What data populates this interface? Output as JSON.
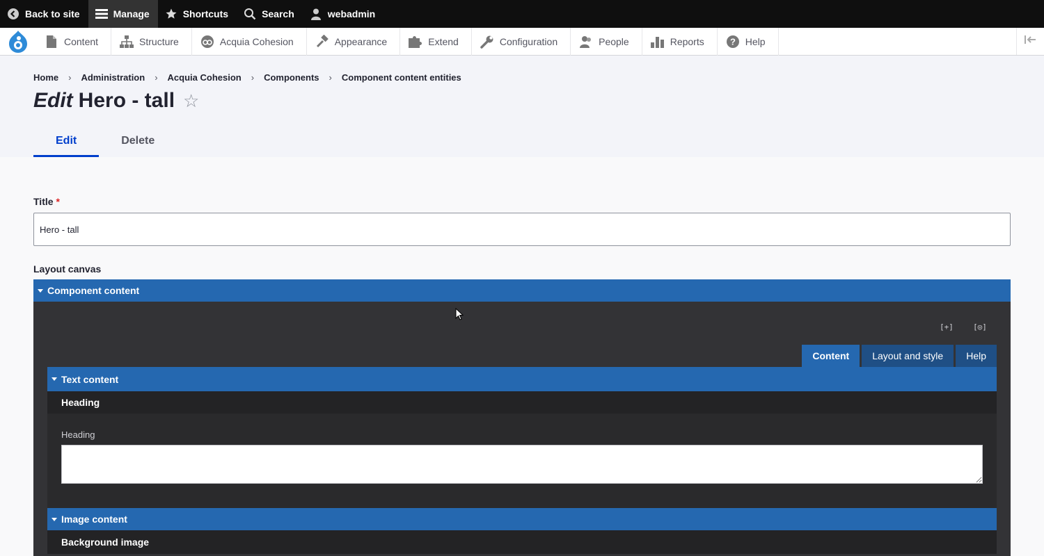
{
  "toolbar": {
    "back": "Back to site",
    "manage": "Manage",
    "shortcuts": "Shortcuts",
    "search": "Search",
    "user": "webadmin"
  },
  "tray": {
    "items": [
      "Content",
      "Structure",
      "Acquia Cohesion",
      "Appearance",
      "Extend",
      "Configuration",
      "People",
      "Reports",
      "Help"
    ],
    "icons": [
      "file-icon",
      "structure-icon",
      "cohesion-icon",
      "hammer-icon",
      "puzzle-icon",
      "wrench-icon",
      "people-icon",
      "reports-icon",
      "help-icon"
    ]
  },
  "breadcrumb": [
    "Home",
    "Administration",
    "Acquia Cohesion",
    "Components",
    "Component content entities"
  ],
  "page": {
    "title_prefix": "Edit",
    "title": "Hero - tall",
    "star": "☆"
  },
  "tabs": [
    "Edit",
    "Delete"
  ],
  "form": {
    "title_label": "Title",
    "required_mark": "*",
    "title_value": "Hero - tall",
    "layout_canvas_label": "Layout canvas"
  },
  "canvas": {
    "component_content": "Component content",
    "expand_icon": "[+]",
    "preview_icon": "[◎]",
    "tabs": [
      "Content",
      "Layout and style",
      "Help"
    ],
    "text_content": "Text content",
    "heading_section": "Heading",
    "heading_field_label": "Heading",
    "heading_value": "",
    "image_content": "Image content",
    "background_image": "Background image"
  },
  "colors": {
    "accent": "#003ecc",
    "canvas_blue": "#2568b0",
    "canvas_dark": "#333336"
  }
}
